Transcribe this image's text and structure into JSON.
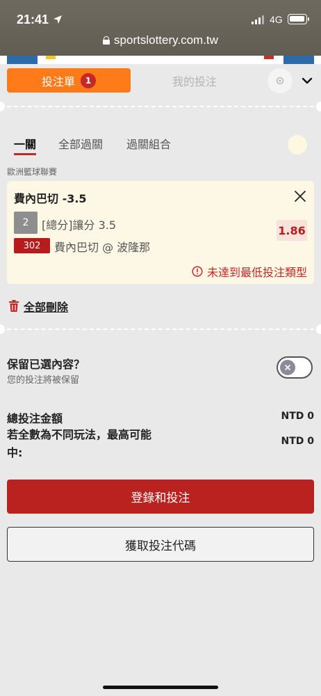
{
  "status": {
    "time": "21:41",
    "network": "4G"
  },
  "browser": {
    "url": "sportslottery.com.tw"
  },
  "header": {
    "betslip_label": "投注單",
    "betslip_count": "1",
    "mybets_label": "我的投注"
  },
  "mode_tabs": [
    "一關",
    "全部過關",
    "過關組合"
  ],
  "league": "歐洲籃球聯賽",
  "bet": {
    "title": "費內巴切 -3.5",
    "number": "2",
    "market": "[總分]讓分 3.5",
    "team_code": "302",
    "matchup": "費內巴切 @ 波隆那",
    "odds": "1.86",
    "warning": "未達到最低投注類型"
  },
  "delete_all_label": "全部刪除",
  "retain": {
    "title": "保留已選內容？",
    "subtitle": "您的投注將被保留",
    "enabled": false
  },
  "totals": {
    "total_label": "總投注金額",
    "total_value": "NTD 0",
    "max_label": "若全數為不同玩法，最高可能中:",
    "max_value": "NTD 0"
  },
  "buttons": {
    "login_bet": "登錄和投注",
    "get_code": "獲取投注代碼"
  },
  "colors": {
    "accent_orange": "#ff7a18",
    "brand_red": "#b9221e",
    "background": "#e9e9ea"
  }
}
